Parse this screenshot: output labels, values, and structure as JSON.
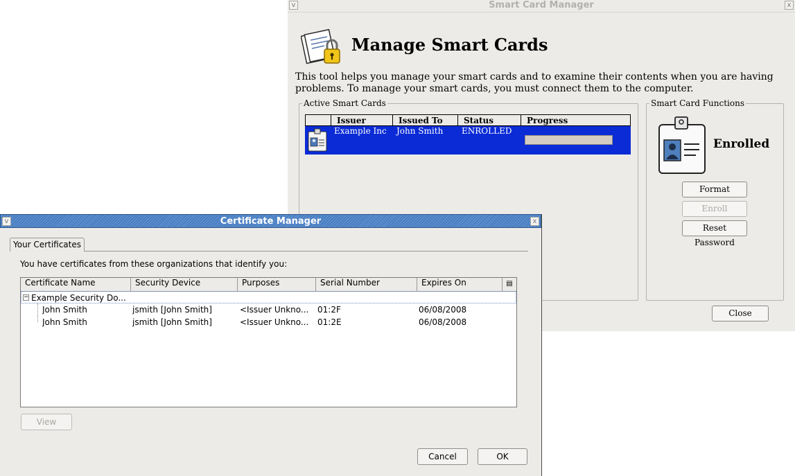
{
  "smart_card_manager": {
    "window_title": "Smart Card Manager",
    "minimize_glyph": "v",
    "close_glyph": "x",
    "heading": "Manage Smart Cards",
    "description": "This tool helps you manage your smart cards and to examine their contents when you are having problems. To manage your smart cards, you must connect them to the computer.",
    "active_cards": {
      "legend": "Active Smart Cards",
      "columns": [
        "Issuer",
        "Issued To",
        "Status",
        "Progress"
      ],
      "rows": [
        {
          "issuer": "Example Inc",
          "issued_to": "John Smith",
          "status": "ENROLLED",
          "progress": 0
        }
      ]
    },
    "functions": {
      "legend": "Smart Card Functions",
      "state_label": "Enrolled",
      "format_label": "Format",
      "enroll_label": "Enroll",
      "reset_password_label": "Reset Password"
    },
    "close_label": "Close",
    "colors": {
      "selection": "#0a2bd6",
      "background": "#edebe8"
    }
  },
  "certificate_manager": {
    "window_title": "Certificate Manager",
    "minimize_glyph": "v",
    "close_glyph": "x",
    "tab_label": "Your Certificates",
    "intro": "You have certificates from these organizations that identify you:",
    "columns": [
      "Certificate Name",
      "Security Device",
      "Purposes",
      "Serial Number",
      "Expires On"
    ],
    "groups": [
      {
        "name": "Example Security Do...",
        "expanded": true,
        "certificates": [
          {
            "name": "John Smith",
            "device": "jsmith [John Smith]",
            "purposes": "<Issuer Unkno...",
            "serial": "01:2F",
            "expires": "06/08/2008"
          },
          {
            "name": "John Smith",
            "device": "jsmith [John Smith]",
            "purposes": "<Issuer Unkno...",
            "serial": "01:2E",
            "expires": "06/08/2008"
          }
        ]
      }
    ],
    "view_label": "View",
    "cancel_label": "Cancel",
    "ok_label": "OK",
    "colors": {
      "titlebar": "#4a7fc1"
    }
  }
}
